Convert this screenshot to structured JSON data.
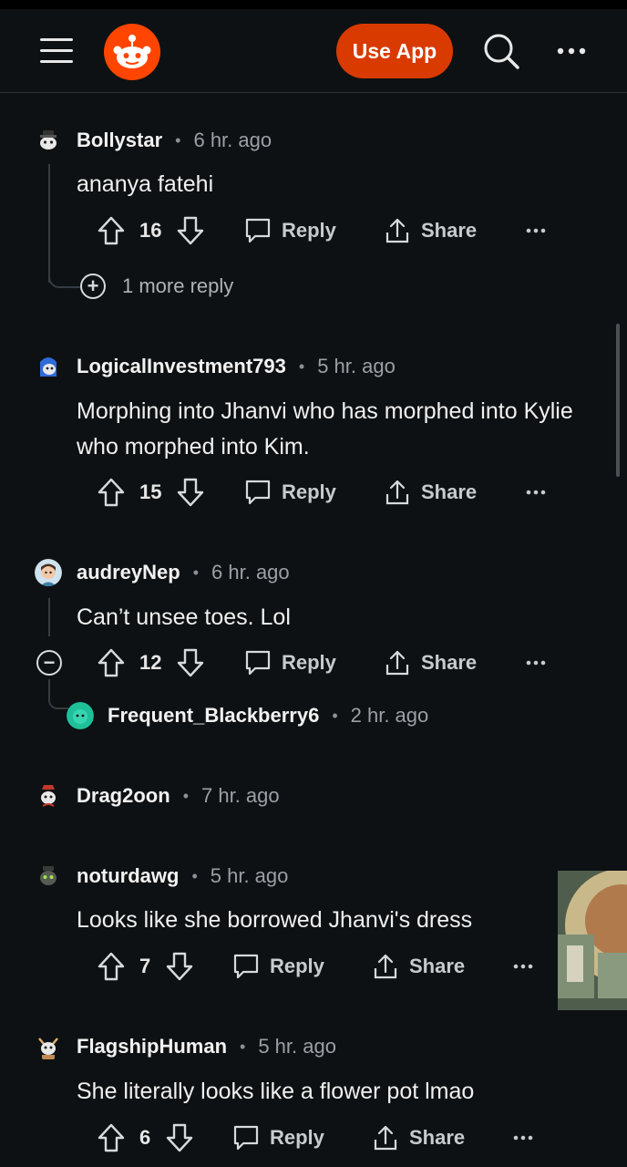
{
  "header": {
    "use_app_label": "Use App"
  },
  "icons": {
    "menu": "hamburger-icon",
    "logo": "reddit-logo",
    "search": "search-icon",
    "more": "more-icon",
    "upvote": "arrow-up-icon",
    "downvote": "arrow-down-icon",
    "reply": "chat-bubble-icon",
    "share": "share-icon"
  },
  "colors": {
    "background": "#0e1113",
    "brand": "#ff4500",
    "use_app_button": "#d93a00"
  },
  "comments": [
    {
      "user": "Bollystar",
      "time": "6 hr. ago",
      "text": "ananya fatehi",
      "votes": "16",
      "reply": "Reply",
      "share": "Share",
      "more_replies": "1 more reply"
    },
    {
      "user": "LogicalInvestment793",
      "time": "5 hr. ago",
      "text": "Morphing into Jhanvi who has morphed into Kylie who morphed into Kim.",
      "votes": "15",
      "reply": "Reply",
      "share": "Share"
    },
    {
      "user": "audreyNep",
      "time": "6 hr. ago",
      "text": "Can’t unsee toes. Lol",
      "votes": "12",
      "reply": "Reply",
      "share": "Share",
      "child": {
        "user": "Frequent_Blackberry6",
        "time": "2 hr. ago"
      }
    },
    {
      "user": "Drag2oon",
      "time": "7 hr. ago"
    },
    {
      "user": "noturdawg",
      "time": "5 hr. ago",
      "text": "Looks like she borrowed Jhanvi's dress",
      "votes": "7",
      "reply": "Reply",
      "share": "Share"
    },
    {
      "user": "FlagshipHuman",
      "time": "5 hr. ago",
      "text": "She literally looks like a flower pot lmao",
      "votes": "6",
      "reply": "Reply",
      "share": "Share"
    }
  ]
}
